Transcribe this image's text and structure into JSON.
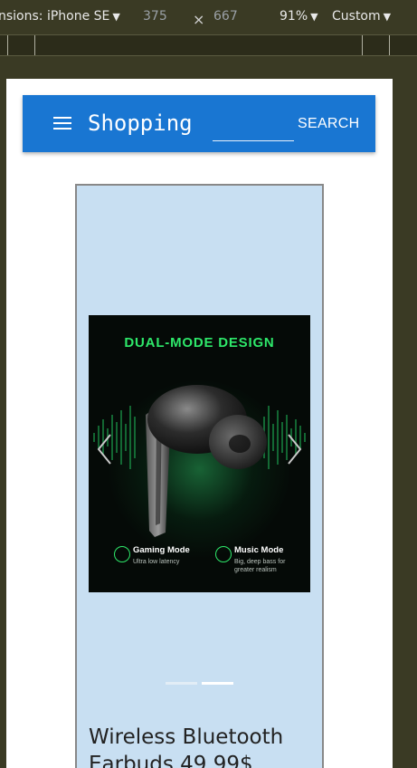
{
  "devtools": {
    "device_label": "nsions: iPhone SE",
    "width": "375",
    "times": "×",
    "height": "667",
    "zoom": "91%",
    "throttle": "Custom"
  },
  "appbar": {
    "title": "Shopping",
    "search_value": "",
    "search_button": "SEARCH"
  },
  "product": {
    "image": {
      "heading": "DUAL-MODE DESIGN",
      "gaming_title": "Gaming Mode",
      "gaming_desc": "Ultra low latency",
      "music_title": "Music Mode",
      "music_desc": "Big, deep bass for greater realism"
    },
    "carousel": {
      "slide_count": 2,
      "active_slide": 2
    },
    "title": "Wireless Bluetooth Earbuds 49.99$"
  },
  "colors": {
    "appbar": "#1976d2",
    "card": "#c8dff2",
    "accent_green": "#2ee86a",
    "devtools_bg": "#3a3a24"
  }
}
